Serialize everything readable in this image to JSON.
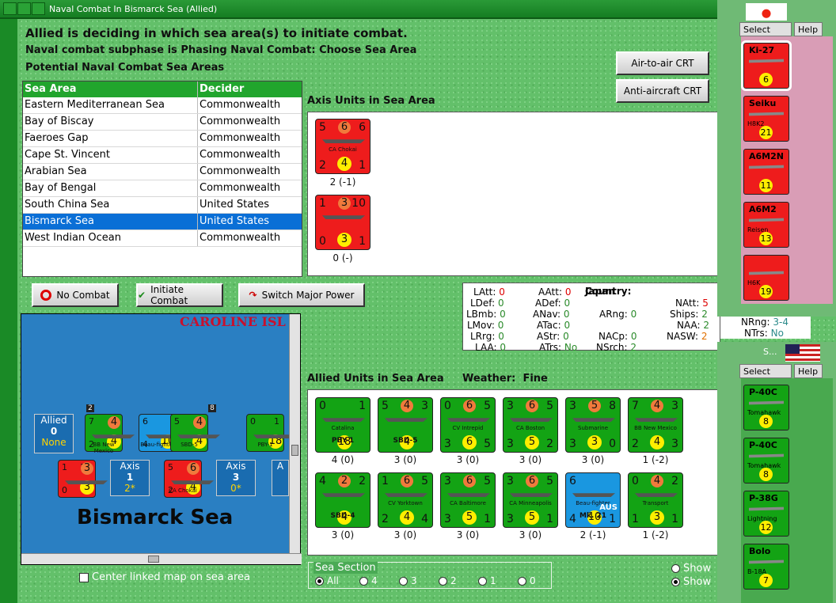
{
  "window": {
    "title": "Naval Combat In Bismarck Sea (Allied)"
  },
  "headings": {
    "line1": "Allied is deciding in which sea area(s) to initiate combat.",
    "line2": "Naval combat subphase is Phasing Naval Combat: Choose Sea Area",
    "line3": "Potential Naval Combat Sea Areas"
  },
  "table": {
    "col1": "Sea Area",
    "col2": "Decider",
    "rows": [
      {
        "area": "Eastern Mediterranean Sea",
        "decider": "Commonwealth"
      },
      {
        "area": "Bay of Biscay",
        "decider": "Commonwealth"
      },
      {
        "area": "Faeroes Gap",
        "decider": "Commonwealth"
      },
      {
        "area": "Cape St. Vincent",
        "decider": "Commonwealth"
      },
      {
        "area": "Arabian Sea",
        "decider": "Commonwealth"
      },
      {
        "area": "Bay of Bengal",
        "decider": "Commonwealth"
      },
      {
        "area": "South China Sea",
        "decider": "United States"
      },
      {
        "area": "Bismarck Sea",
        "decider": "United States"
      },
      {
        "area": "West Indian Ocean",
        "decider": "Commonwealth"
      }
    ],
    "selected_index": 7
  },
  "buttons": {
    "air_to_air": "Air-to-air CRT",
    "anti_aircraft": "Anti-aircraft CRT",
    "no_combat": "No Combat",
    "initiate": "Initiate Combat",
    "switch": "Switch Major Power"
  },
  "axis": {
    "title": "Axis Units in Sea Area",
    "units": [
      {
        "tl": "5",
        "tc": "6",
        "tr": "6",
        "name": "CA Chokai",
        "bl": "2",
        "bc": "4",
        "br": "1",
        "sub": "2 (-1)"
      },
      {
        "tl": "1",
        "tc": "3",
        "tr": "10",
        "name": "",
        "bl": "0",
        "bc": "3",
        "br": "1",
        "sub": "0 (-)"
      }
    ]
  },
  "stats": {
    "LAtt": "0",
    "LDef": "0",
    "LBmb": "0",
    "LMov": "0",
    "LRrg": "0",
    "LAA": "0",
    "AAtt": "0",
    "ADef": "0",
    "ANav": "0",
    "ATac": "0",
    "AStr": "0",
    "ATrs": "No",
    "country_label": "Country:",
    "country": "Japan",
    "ARng": "0",
    "NACp": "0",
    "NSrch": "2",
    "NAtt": "5",
    "Ships": "2",
    "NAA": "2",
    "NASW": "2",
    "NRng": "3-4",
    "NTrs": "No"
  },
  "weather": {
    "label": "Weather:",
    "value": "Fine"
  },
  "allied": {
    "title": "Allied Units in Sea Area",
    "units": [
      {
        "tl": "0",
        "tc": "",
        "tr": "1",
        "name": "Catalina",
        "model": "PBY-1",
        "bl": "",
        "bc": "18",
        "br": "",
        "sub": "4 (0)",
        "color": "grn",
        "tag": "blue"
      },
      {
        "tl": "5",
        "tc": "4",
        "tr": "3",
        "name": "",
        "model": "SBD-5",
        "bl": "",
        "bc": "4",
        "br": "",
        "sub": "3 (0)",
        "color": "grn",
        "tag": "blue"
      },
      {
        "tl": "0",
        "tc": "6",
        "tr": "5",
        "name": "CV Intrepid",
        "model": "",
        "bl": "3",
        "bc": "6",
        "br": "5",
        "sub": "3 (0)",
        "color": "grn",
        "tag": "red"
      },
      {
        "tl": "3",
        "tc": "6",
        "tr": "5",
        "name": "CA Boston",
        "model": "",
        "bl": "3",
        "bc": "5",
        "br": "2",
        "sub": "3 (0)",
        "color": "grn",
        "tag": ""
      },
      {
        "tl": "3",
        "tc": "5",
        "tr": "8",
        "name": "Submarine",
        "model": "",
        "bl": "3",
        "bc": "3",
        "br": "0",
        "sub": "3 (0)",
        "color": "grn",
        "tag": ""
      },
      {
        "tl": "7",
        "tc": "4",
        "tr": "3",
        "name": "BB New Mexico",
        "model": "",
        "bl": "2",
        "bc": "4",
        "br": "3",
        "sub": "1 (-2)",
        "color": "grn",
        "tag": ""
      },
      {
        "tl": "4",
        "tc": "2",
        "tr": "2",
        "name": "",
        "model": "SBD-4",
        "bl": "",
        "bc": "4",
        "br": "",
        "sub": "3 (0)",
        "color": "grn",
        "tag": ""
      },
      {
        "tl": "1",
        "tc": "6",
        "tr": "5",
        "name": "CV Yorktown",
        "model": "",
        "bl": "2",
        "bc": "4",
        "br": "4",
        "sub": "3 (0)",
        "color": "grn",
        "tag": "blue"
      },
      {
        "tl": "3",
        "tc": "6",
        "tr": "5",
        "name": "CA Baltimore",
        "model": "",
        "bl": "3",
        "bc": "5",
        "br": "1",
        "sub": "3 (0)",
        "color": "grn",
        "tag": ""
      },
      {
        "tl": "3",
        "tc": "6",
        "tr": "5",
        "name": "CA Minneapolis",
        "model": "",
        "bl": "3",
        "bc": "5",
        "br": "1",
        "sub": "3 (0)",
        "color": "grn",
        "tag": ""
      },
      {
        "tl": "6",
        "tc": "",
        "tr": "",
        "name": "Beau-fighter",
        "model": "Mk. 21",
        "bl": "4",
        "bc": "10",
        "br": "1",
        "sub": "2 (-1)",
        "color": "blu",
        "tag": "AUS"
      },
      {
        "tl": "0",
        "tc": "4",
        "tr": "2",
        "name": "Transport",
        "model": "",
        "bl": "1",
        "bc": "3",
        "br": "1",
        "sub": "1 (-2)",
        "color": "grn",
        "tag": ""
      }
    ]
  },
  "map": {
    "label_top": "CAROLINE ISL",
    "label_main": "Bismarck Sea",
    "allied_box": {
      "title": "Allied",
      "num": "0",
      "sub": "None"
    },
    "axis_boxes": [
      {
        "title": "Axis",
        "num": "1",
        "sub": "2*"
      },
      {
        "title": "Axis",
        "num": "3",
        "sub": "0*"
      },
      {
        "title": "A"
      }
    ],
    "mini_units": [
      {
        "tl": "7",
        "tc": "4",
        "tr": "3",
        "bl": "2",
        "bc": "4",
        "br": "3",
        "name": "BB New Mexico",
        "color": "grn"
      },
      {
        "tl": "6",
        "tc": "",
        "tr": "",
        "bl": "4",
        "bc": "10",
        "br": "1",
        "name": "Beau-fighter",
        "color": "blu"
      },
      {
        "tl": "5",
        "tc": "4",
        "tr": "3",
        "bl": "",
        "bc": "4",
        "br": "",
        "name": "SBD-5",
        "color": "grn"
      },
      {
        "tl": "0",
        "tc": "",
        "tr": "1",
        "bl": "",
        "bc": "18",
        "br": "",
        "name": "PBY-1",
        "color": "grn"
      },
      {
        "tl": "1",
        "tc": "3",
        "tr": "10",
        "bl": "0",
        "bc": "3",
        "br": "1",
        "name": "",
        "color": "red"
      },
      {
        "tl": "5",
        "tc": "6",
        "tr": "6",
        "bl": "2",
        "bc": "4",
        "br": "1",
        "name": "CA Chokai",
        "color": "red"
      }
    ],
    "stack_nums": [
      "2",
      "",
      "8"
    ]
  },
  "center_checkbox": "Center linked map on sea area",
  "sea_section": {
    "title": "Sea Section",
    "options": [
      "All",
      "4",
      "3",
      "2",
      "1",
      "0"
    ],
    "selected": "All"
  },
  "show": {
    "opt1": "Show",
    "opt2": "Show"
  },
  "side_jp": {
    "select": "Select",
    "help": "Help",
    "units": [
      {
        "name": "Ki-27",
        "num": "6",
        "color": "red"
      },
      {
        "name": "Seiku",
        "num": "21",
        "color": "red",
        "extra": "H8K2"
      },
      {
        "name": "A6M2N",
        "num": "11",
        "color": "red"
      },
      {
        "name": "A6M2",
        "num": "13",
        "color": "red",
        "extra": "Reisen"
      },
      {
        "name": "",
        "num": "19",
        "color": "red",
        "extra": "H6K"
      }
    ]
  },
  "side_us": {
    "title": "S...",
    "select": "Select",
    "help": "Help",
    "units": [
      {
        "name": "P-40C",
        "num": "8",
        "color": "grn",
        "extra": "Tomahawk"
      },
      {
        "name": "P-40C",
        "num": "8",
        "color": "grn",
        "extra": "Tomahawk"
      },
      {
        "name": "P-38G",
        "num": "12",
        "color": "grn",
        "extra": "Lightning"
      },
      {
        "name": "Bolo",
        "num": "7",
        "color": "grn",
        "extra": "B-18A"
      }
    ]
  }
}
